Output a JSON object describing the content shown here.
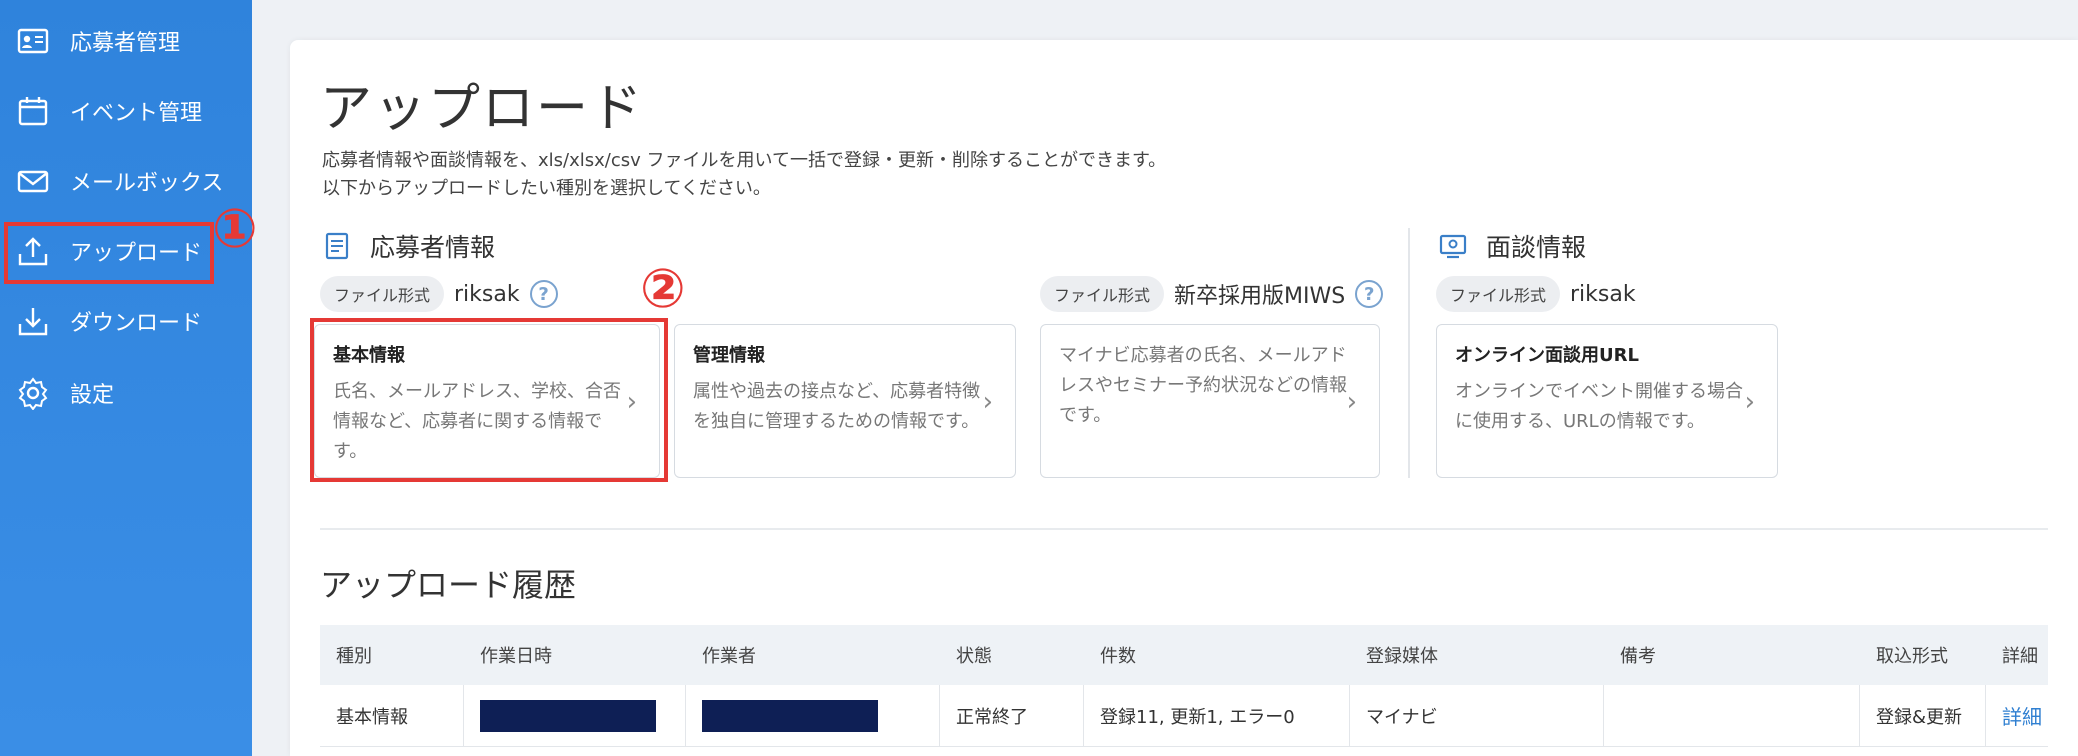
{
  "sidebar": {
    "items": [
      {
        "label": "応募者管理",
        "icon": "id-card-icon"
      },
      {
        "label": "イベント管理",
        "icon": "calendar-icon"
      },
      {
        "label": "メールボックス",
        "icon": "mail-icon"
      },
      {
        "label": "アップロード",
        "icon": "upload-icon"
      },
      {
        "label": "ダウンロード",
        "icon": "download-icon"
      },
      {
        "label": "設定",
        "icon": "gear-icon"
      }
    ]
  },
  "annotations": {
    "step1": "①",
    "step2": "②"
  },
  "page": {
    "title": "アップロード",
    "desc1": "応募者情報や面談情報を、xls/xlsx/csv ファイルを用いて一括で登録・更新・削除することができます。",
    "desc2": "以下からアップロードしたい種別を選択してください。"
  },
  "applicant_section": {
    "title": "応募者情報",
    "icon": "document-icon",
    "format_label": "ファイル形式",
    "format_value": "riksak",
    "format_label2": "ファイル形式",
    "format_value2": "新卒採用版MIWS",
    "help": "?"
  },
  "interview_section": {
    "title": "面談情報",
    "icon": "monitor-icon",
    "format_label": "ファイル形式",
    "format_value": "riksak"
  },
  "cards": [
    {
      "title": "基本情報",
      "desc": "氏名、メールアドレス、学校、合否情報など、応募者に関する情報です。"
    },
    {
      "title": "管理情報",
      "desc": "属性や過去の接点など、応募者特徴を独自に管理するための情報です。"
    },
    {
      "title": "",
      "desc": "マイナビ応募者の氏名、メールアドレスやセミナー予約状況などの情報です。"
    },
    {
      "title": "オンライン面談用URL",
      "desc": "オンラインでイベント開催する場合に使用する、URLの情報です。"
    }
  ],
  "chevron": "›",
  "history": {
    "title": "アップロード履歴",
    "columns": [
      "種別",
      "作業日時",
      "作業者",
      "状態",
      "件数",
      "登録媒体",
      "備考",
      "取込形式",
      "詳細"
    ],
    "rows": [
      {
        "type": "基本情報",
        "status": "正常終了",
        "count": "登録11, 更新1, エラー0",
        "media": "マイナビ",
        "note": "",
        "mode": "登録&更新",
        "detail": "詳細"
      }
    ]
  }
}
